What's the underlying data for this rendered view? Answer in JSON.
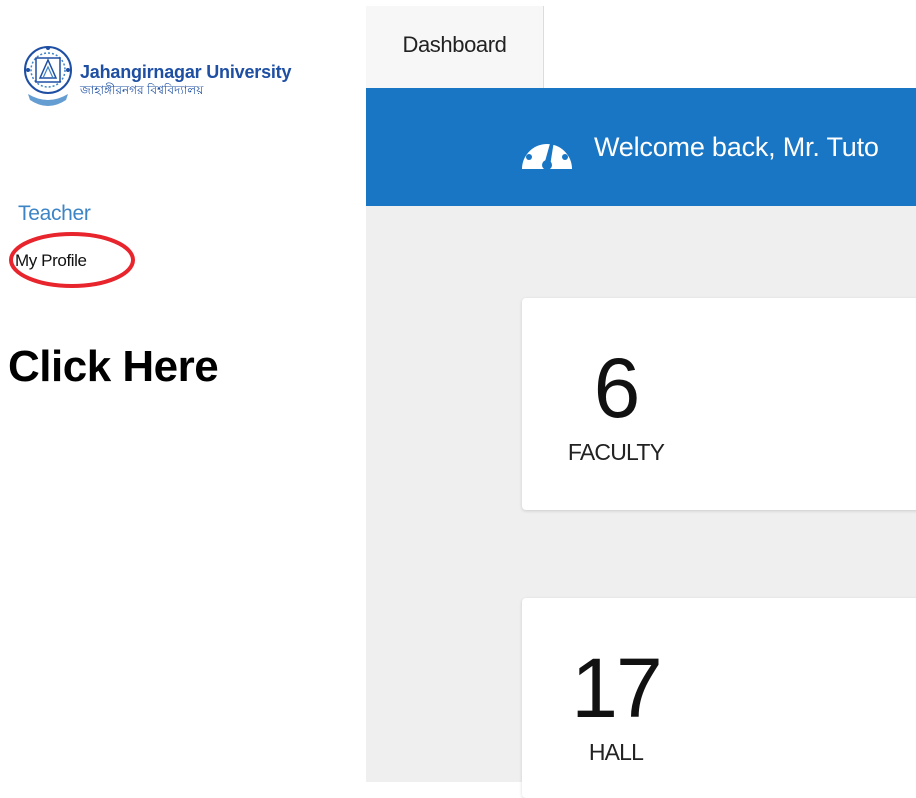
{
  "sidebar": {
    "logo": {
      "title": "Jahangirnagar University",
      "subtitle": "জাহাঙ্গীরনগর বিশ্ববিদ্যালয়",
      "icon": "university-seal-icon"
    },
    "section_label": "Teacher",
    "profile_link": "My Profile",
    "annotation": "Click Here",
    "highlight_color": "#e8242c"
  },
  "main": {
    "tabs": [
      {
        "label": "Dashboard",
        "active": true
      }
    ],
    "banner": {
      "icon": "speedometer-icon",
      "text": "Welcome back, Mr. Tuto",
      "color": "#1976c4"
    },
    "cards": [
      {
        "value": "6",
        "label": "FACULTY"
      },
      {
        "value": "17",
        "label": "HALL"
      }
    ]
  }
}
